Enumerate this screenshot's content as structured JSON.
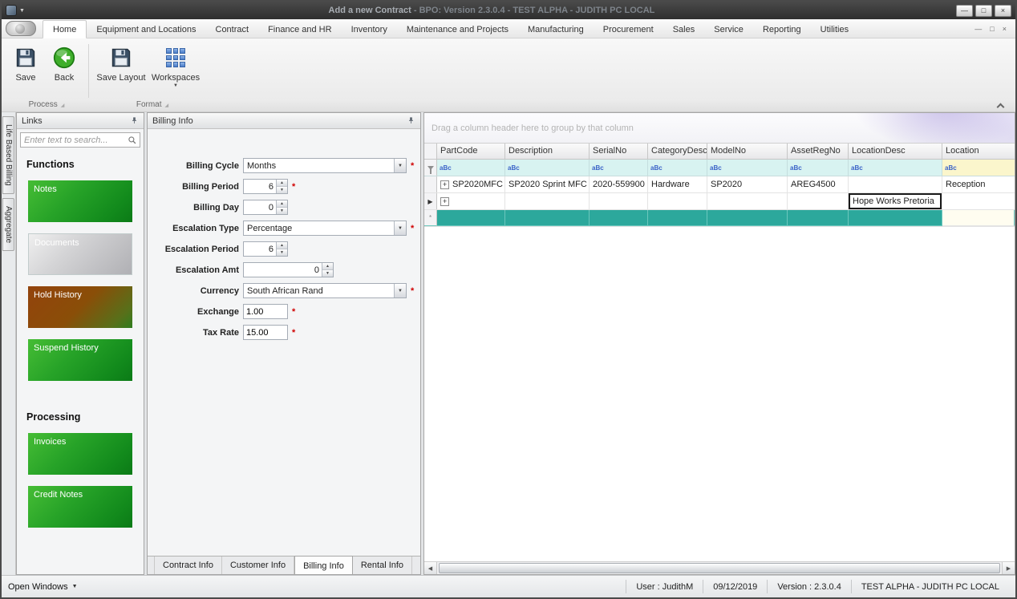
{
  "window": {
    "title": "Add a new Contract",
    "subtitle": " - BPO: Version 2.3.0.4 - TEST ALPHA - JUDITH PC LOCAL"
  },
  "icons": {
    "minimize": "—",
    "restore": "□",
    "close": "×",
    "dropdown_arrow": "▼",
    "spin_up": "▲",
    "spin_down": "▼",
    "expand_plus": "+",
    "current_row_arrow": "▶",
    "new_row_star": "*",
    "scroll_left": "◀",
    "scroll_right": "▶",
    "launcher": "◢"
  },
  "ribbon": {
    "tabs": [
      "Home",
      "Equipment and Locations",
      "Contract",
      "Finance and HR",
      "Inventory",
      "Maintenance and Projects",
      "Manufacturing",
      "Procurement",
      "Sales",
      "Service",
      "Reporting",
      "Utilities"
    ],
    "active_tab": "Home",
    "buttons": {
      "save": "Save",
      "back": "Back",
      "save_layout": "Save Layout",
      "workspaces": "Workspaces"
    },
    "groups": {
      "process": "Process",
      "format": "Format"
    }
  },
  "side_tabs": {
    "tab1": "Life Based Billing",
    "tab2": "Aggregate"
  },
  "links": {
    "title": "Links",
    "search_placeholder": "Enter text to search...",
    "functions_heading": "Functions",
    "processing_heading": "Processing",
    "buttons": {
      "notes": "Notes",
      "documents": "Documents",
      "hold_history": "Hold History",
      "suspend_history": "Suspend History",
      "invoices": "Invoices",
      "credit_notes": "Credit Notes"
    }
  },
  "billing": {
    "title": "Billing Info",
    "required_marker": "*",
    "fields": [
      {
        "label": "Billing Cycle",
        "value": "Months",
        "type": "select",
        "required": true
      },
      {
        "label": "Billing Period",
        "value": "6",
        "type": "spinner",
        "required": true
      },
      {
        "label": "Billing Day",
        "value": "0",
        "type": "spinner",
        "required": false
      },
      {
        "label": "Escalation Type",
        "value": "Percentage",
        "type": "select",
        "required": true
      },
      {
        "label": "Escalation Period",
        "value": "6",
        "type": "spinner",
        "required": false
      },
      {
        "label": "Escalation Amt",
        "value": "0",
        "type": "spinner",
        "required": false
      },
      {
        "label": "Currency",
        "value": "South African Rand",
        "type": "select",
        "required": true
      },
      {
        "label": "Exchange",
        "value": "1.00",
        "type": "text",
        "required": true
      },
      {
        "label": "Tax Rate",
        "value": "15.00",
        "type": "text",
        "required": true
      }
    ],
    "tabs": [
      "Contract Info",
      "Customer Info",
      "Billing Info",
      "Rental Info"
    ],
    "active_tab": "Billing Info"
  },
  "grid": {
    "group_hint": "Drag a column header here to group by that column",
    "columns": [
      "PartCode",
      "Description",
      "SerialNo",
      "CategoryDesc",
      "ModelNo",
      "AssetRegNo",
      "LocationDesc",
      "Location"
    ],
    "filter_icon_text": "aBc",
    "rows": [
      {
        "cells": [
          "SP2020MFC",
          "SP2020 Sprint MFC",
          "2020-559900",
          "Hardware",
          "SP2020",
          "AREG4500",
          "",
          "Reception"
        ]
      },
      {
        "cells": [
          "",
          "",
          "",
          "",
          "",
          "",
          "Hope Works Pretoria",
          ""
        ],
        "editing_column": "LocationDesc"
      }
    ]
  },
  "status": {
    "open_windows": "Open Windows",
    "user": "User : JudithM",
    "date": "09/12/2019",
    "version": "Version : 2.3.0.4",
    "environment": "TEST ALPHA - JUDITH PC LOCAL"
  }
}
